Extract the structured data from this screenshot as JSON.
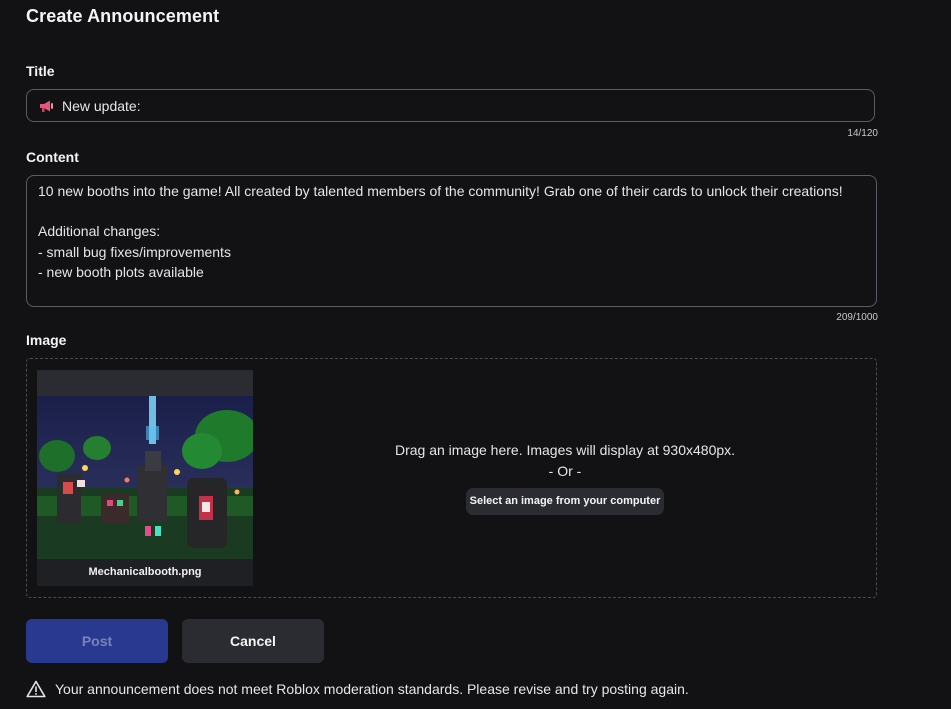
{
  "header": {
    "title": "Create Announcement"
  },
  "title_section": {
    "label": "Title",
    "value": "New update:",
    "icon": "megaphone-icon",
    "counter": "14/120"
  },
  "content_section": {
    "label": "Content",
    "value": "10 new booths into the game! All created by talented members of the community! Grab one of their cards to unlock their creations!\n\nAdditional changes:\n- small bug fixes/improvements\n- new booth plots available",
    "counter": "209/1000"
  },
  "image_section": {
    "label": "Image",
    "file_name": "Mechanicalbooth.png",
    "drop_text": "Drag an image here. Images will display at 930x480px.",
    "or_text": "- Or -",
    "select_button": "Select an image from your computer"
  },
  "actions": {
    "post_label": "Post",
    "cancel_label": "Cancel"
  },
  "warning": {
    "icon": "warning-icon",
    "text": "Your announcement does not meet Roblox moderation standards. Please revise and try posting again."
  },
  "colors": {
    "background": "#121215",
    "post_button": "#2a3990",
    "secondary_button": "#2b2c31",
    "border": "#5b5c61"
  }
}
